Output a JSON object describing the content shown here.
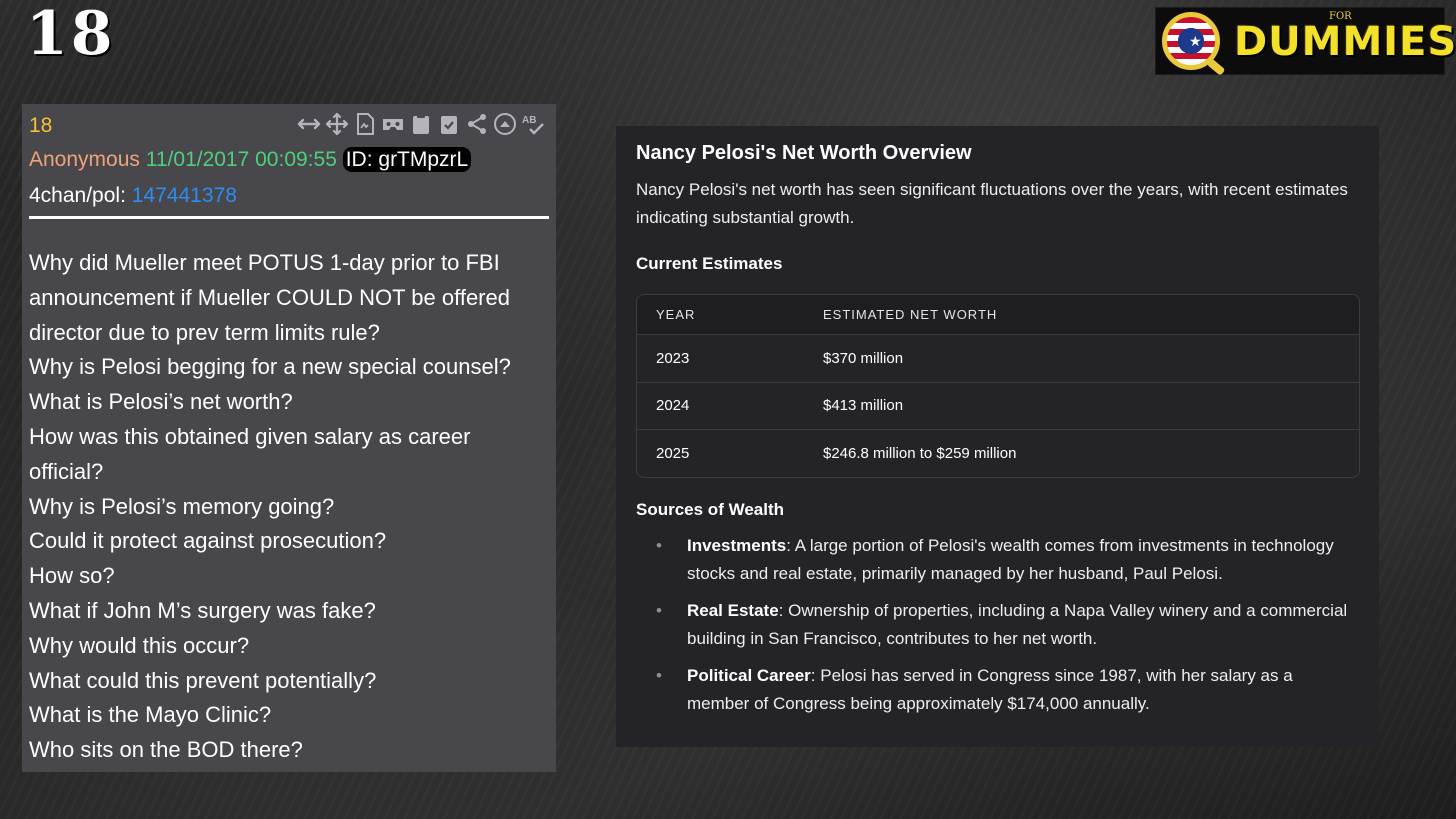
{
  "slide_number": "18",
  "logo": {
    "for_text": "FOR",
    "dummies_text": "DUMMIES"
  },
  "drop": {
    "number": "18",
    "author": "Anonymous",
    "datetime": "11/01/2017 00:09:55",
    "id_label": "ID: grTMpzrL",
    "board": "4chan/pol:",
    "post_link": "147441378",
    "toolbar_icons": [
      "resize-horizontal-icon",
      "move-icon",
      "document-icon",
      "vr-icon",
      "clipboard-icon",
      "clipboard-check-icon",
      "share-icon",
      "collapse-icon",
      "spellcheck-icon"
    ],
    "lines": [
      "Why did Mueller meet POTUS 1-day prior to FBI",
      "announcement if Mueller COULD NOT be offered",
      "director due to prev term limits rule?",
      "Why is Pelosi begging for a new special counsel?",
      "What is Pelosi’s net worth?",
      "How was this obtained given salary as career",
      "official?",
      "Why is Pelosi’s memory going?",
      "Could it protect against prosecution?",
      "How so?",
      "What if John M’s surgery was fake?",
      "Why would this occur?",
      "What could this prevent potentially?",
      "What is the Mayo Clinic?",
      "Who sits on the BOD there?"
    ]
  },
  "answer": {
    "title": "Nancy Pelosi's Net Worth Overview",
    "intro": "Nancy Pelosi's net worth has seen significant fluctuations over the years, with recent estimates indicating substantial growth.",
    "current_heading": "Current Estimates",
    "table": {
      "headers": [
        "YEAR",
        "ESTIMATED NET WORTH"
      ],
      "rows": [
        [
          "2023",
          "$370 million"
        ],
        [
          "2024",
          "$413 million"
        ],
        [
          "2025",
          "$246.8 million to $259 million"
        ]
      ]
    },
    "sources_heading": "Sources of Wealth",
    "sources": [
      {
        "label": "Investments",
        "text": ": A large portion of Pelosi's wealth comes from investments in technology stocks and real estate, primarily managed by her husband, Paul Pelosi."
      },
      {
        "label": "Real Estate",
        "text": ": Ownership of properties, including a Napa Valley winery and a commercial building in San Francisco, contributes to her net worth."
      },
      {
        "label": "Political Career",
        "text": ": Pelosi has served in Congress since 1987, with her salary as a member of Congress being approximately $174,000 annually."
      }
    ]
  }
}
